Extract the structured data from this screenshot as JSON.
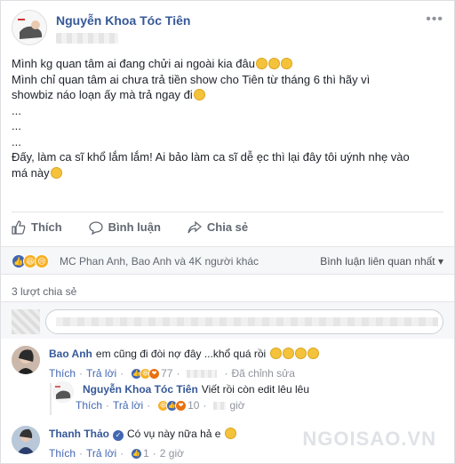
{
  "post": {
    "author": "Nguyễn Khoa Tóc Tiên",
    "menu": "•••",
    "lines": [
      "Mình kg quan tâm ai đang chửi ai ngoài kia đâu",
      "Mình chỉ quan tâm ai chưa trả tiền show cho Tiên từ tháng 6 thì hãy vì",
      "showbiz náo loạn ấy mà trả ngay đi",
      "...",
      "...",
      "...",
      "Đấy, làm ca sĩ khổ lắm lắm! Ai bảo làm ca sĩ dễ ẹc thì lại đây tôi uýnh nhẹ vào",
      "má này"
    ]
  },
  "actions": {
    "like": "Thích",
    "comment": "Bình luận",
    "share": "Chia sẻ"
  },
  "reactions": {
    "summary": "MC Phan Anh, Bao Anh và 4K người khác",
    "sort": "Bình luận liên quan nhất ▾"
  },
  "shares_count": "3 lượt chia sẻ",
  "comments": [
    {
      "name": "Bao Anh",
      "text": "em cũng đi đòi nợ đây ...khổ quá rồi",
      "like": "Thích",
      "reply": "Trả lời",
      "count": "77",
      "edited": "Đã chỉnh sửa"
    },
    {
      "name": "Nguyễn Khoa Tóc Tiên",
      "text": "Viết rồi còn edit lêu lêu",
      "like": "Thích",
      "reply": "Trả lời",
      "count": "10",
      "time": "giờ"
    },
    {
      "name": "Thanh Thảo",
      "text": "Có vụ này nữa hả e",
      "like": "Thích",
      "reply": "Trả lời",
      "count": "1",
      "time": "2 giờ"
    }
  ],
  "watermark": "NGOISAO.VN",
  "colors": {
    "link": "#365899",
    "like_blue": "#4267b2",
    "muted": "#90949c"
  }
}
